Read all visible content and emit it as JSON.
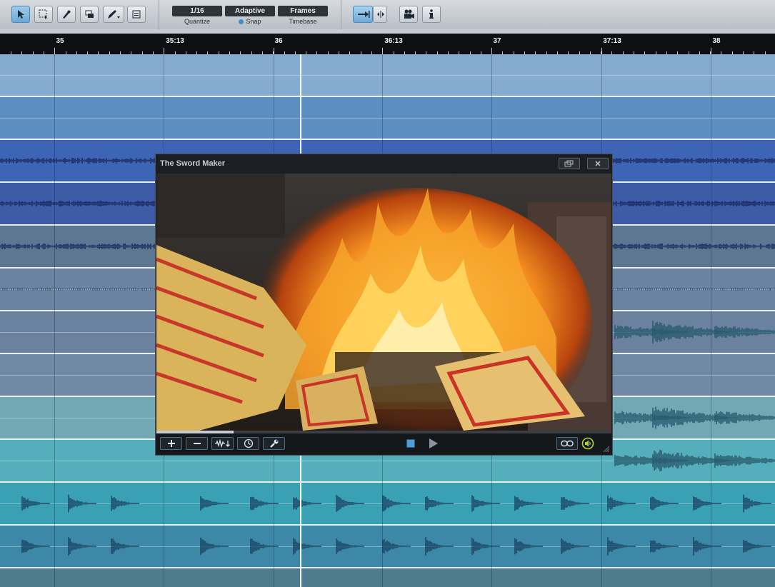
{
  "toolbar": {
    "tools": [
      {
        "icon": "arrow-cursor-icon",
        "active": true
      },
      {
        "icon": "range-select-icon",
        "active": false
      },
      {
        "icon": "split-tool-icon",
        "active": false
      },
      {
        "icon": "eraser-icon",
        "active": false
      },
      {
        "icon": "pencil-icon",
        "active": false
      },
      {
        "icon": "mute-tool-icon",
        "active": false
      }
    ],
    "quantize": {
      "value": "1/16",
      "label": "Quantize"
    },
    "snap": {
      "value": "Adaptive",
      "label": "Snap"
    },
    "timebase": {
      "value": "Frames",
      "label": "Timebase"
    }
  },
  "ruler": {
    "labels": [
      "35",
      "35:13",
      "36",
      "36:13",
      "37",
      "37:13",
      "38"
    ]
  },
  "tracks": [
    {
      "color": "#86abd0",
      "wave": "none"
    },
    {
      "color": "#5c8ec2",
      "wave": "none"
    },
    {
      "color": "#3e65b5",
      "wave": "sustain"
    },
    {
      "color": "#3e5ba8",
      "wave": "sustain"
    },
    {
      "color": "#5d7691",
      "wave": "sustain"
    },
    {
      "color": "#6a83a0",
      "wave": "thin"
    },
    {
      "color": "#6a829f",
      "wave": "burst"
    },
    {
      "color": "#7089a4",
      "wave": "none"
    },
    {
      "color": "#72a8b3",
      "wave": "burst"
    },
    {
      "color": "#55aebb",
      "wave": "burst"
    },
    {
      "color": "#3aa0b4",
      "wave": "drops"
    },
    {
      "color": "#3c88a6",
      "wave": "drops"
    },
    {
      "color": "#4e7c8e",
      "wave": "none"
    }
  ],
  "video_window": {
    "title": "The Sword Maker",
    "progress": 0.17,
    "controls": {
      "zoom_in": "plus-icon",
      "zoom_out": "minus-icon",
      "audio": "waveform-icon",
      "clock": "clock-icon",
      "settings": "wrench-icon",
      "stop": "stop-icon",
      "play": "play-icon",
      "link": "link-icon",
      "sound": "speaker-icon"
    },
    "accent": "#4a9fd8",
    "sound_color": "#b7d32a"
  }
}
